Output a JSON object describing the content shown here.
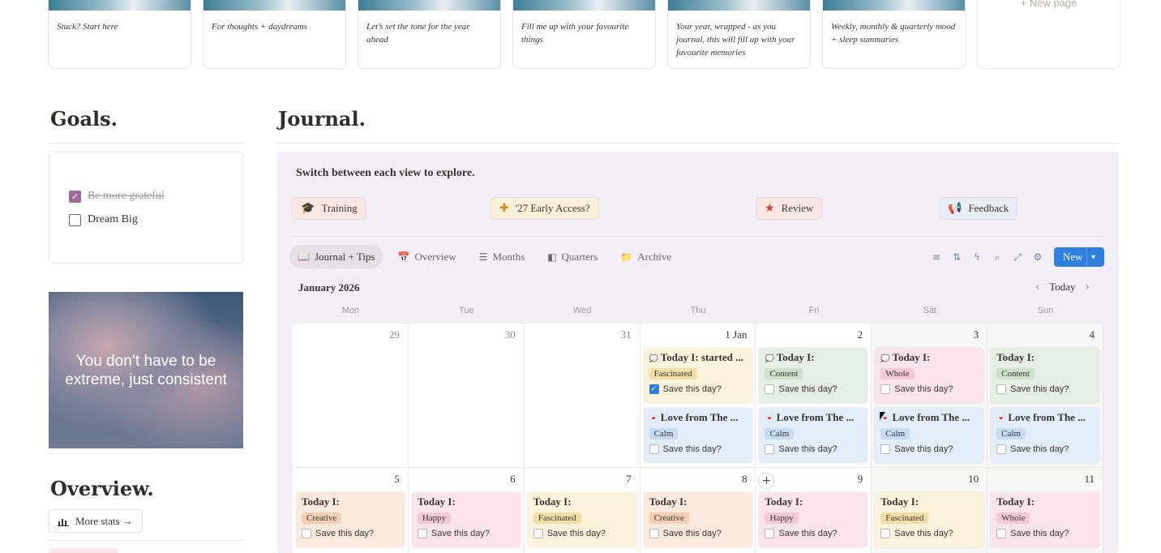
{
  "top_cards": [
    {
      "caption": "Stuck? Start here"
    },
    {
      "caption": "For thoughts + daydreams"
    },
    {
      "caption": "Let’s set the tone for the year ahead"
    },
    {
      "caption": "Fill me up with your favourite things"
    },
    {
      "caption": "Your year, wrapped - as you journal, this will fill up with your favourite memories"
    },
    {
      "caption": "Weekly, monthly & quarterly mood + sleep summaries"
    }
  ],
  "new_page": "+ New page",
  "goals": {
    "title": "Goals.",
    "items": [
      {
        "label": "Be more grateful",
        "done": true
      },
      {
        "label": "Dream Big",
        "done": false
      }
    ]
  },
  "quote": "You don’t have to be extreme, just consistent",
  "overview": {
    "title": "Overview.",
    "more_stats": "More stats →"
  },
  "journal": {
    "title": "Journal.",
    "switch_text": "Switch between each view to explore.",
    "pills": [
      {
        "label": "Training",
        "icon": "graduation-cap-icon"
      },
      {
        "label": "'27 Early Access?",
        "icon": "plus-icon"
      },
      {
        "label": "Review",
        "icon": "star-icon"
      },
      {
        "label": "Feedback",
        "icon": "megaphone-icon"
      }
    ],
    "tabs": [
      {
        "label": "Journal + Tips",
        "icon": "book-icon",
        "active": true
      },
      {
        "label": "Overview",
        "icon": "calendar-icon"
      },
      {
        "label": "Months",
        "icon": "timeline-icon"
      },
      {
        "label": "Quarters",
        "icon": "board-icon"
      },
      {
        "label": "Archive",
        "icon": "folder-icon"
      }
    ],
    "new_label": "New",
    "month": "January 2026",
    "today_label": "Today",
    "weekdays": [
      "Mon",
      "Tue",
      "Wed",
      "Thu",
      "Fri",
      "Sat",
      "Sun"
    ],
    "week1_days": [
      "29",
      "30",
      "31",
      "1 Jan",
      "2",
      "3",
      "4"
    ],
    "week2_days": [
      "5",
      "6",
      "7",
      "8",
      "9",
      "10",
      "11"
    ],
    "save_label": "Save this day?",
    "week1_today": [
      {
        "title": "Today I: started ...",
        "tag": "Fascinated",
        "checked": true
      },
      {
        "title": "Today I:",
        "tag": "Content"
      },
      {
        "title": "Today I:",
        "tag": "Whole"
      },
      {
        "title": "Today I:",
        "tag": "Content"
      }
    ],
    "week1_love": [
      {
        "title": "Love from The ...",
        "tag": "Calm"
      },
      {
        "title": "Love from The ...",
        "tag": "Calm"
      },
      {
        "title": "Love from The ...",
        "tag": "Calm"
      },
      {
        "title": "Love from The ...",
        "tag": "Calm"
      }
    ],
    "week2": [
      {
        "title": "Today I:",
        "tag": "Creative"
      },
      {
        "title": "Today I:",
        "tag": "Happy"
      },
      {
        "title": "Today I:",
        "tag": "Fascinated"
      },
      {
        "title": "Today I:",
        "tag": "Creative"
      },
      {
        "title": "Today I:",
        "tag": "Happy"
      },
      {
        "title": "Today I:",
        "tag": "Fascinated"
      },
      {
        "title": "Today I:",
        "tag": "Whole"
      }
    ]
  }
}
